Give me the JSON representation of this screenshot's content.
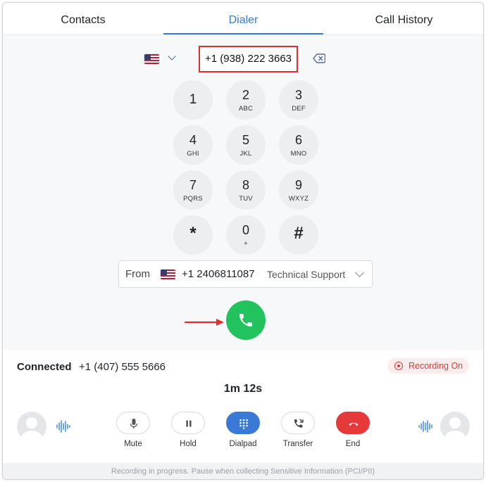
{
  "tabs": [
    {
      "label": "Contacts",
      "active": false
    },
    {
      "label": "Dialer",
      "active": true
    },
    {
      "label": "Call History",
      "active": false
    }
  ],
  "dialer": {
    "country_icon": "us-flag-icon",
    "number": "+1 (938) 222 3663",
    "keys": [
      {
        "digit": "1",
        "letters": ""
      },
      {
        "digit": "2",
        "letters": "ABC"
      },
      {
        "digit": "3",
        "letters": "DEF"
      },
      {
        "digit": "4",
        "letters": "GHI"
      },
      {
        "digit": "5",
        "letters": "JKL"
      },
      {
        "digit": "6",
        "letters": "MNO"
      },
      {
        "digit": "7",
        "letters": "PQRS"
      },
      {
        "digit": "8",
        "letters": "TUV"
      },
      {
        "digit": "9",
        "letters": "WXYZ"
      },
      {
        "digit": "*",
        "letters": ""
      },
      {
        "digit": "0",
        "letters": "+"
      },
      {
        "digit": "#",
        "letters": ""
      }
    ],
    "from": {
      "label": "From",
      "number": "+1 2406811087",
      "name": "Technical Support"
    }
  },
  "call": {
    "status": "Connected",
    "number": "+1 (407) 555 5666",
    "recording": "Recording On",
    "timer": "1m 12s",
    "controls": {
      "mute": "Mute",
      "hold": "Hold",
      "dialpad": "Dialpad",
      "transfer": "Transfer",
      "end": "End"
    }
  },
  "footer": {
    "notice": "Recording in progress. Pause when collecting Sensitive Information (PCI/PII)"
  },
  "colors": {
    "accent": "#3a79d6",
    "call_green": "#22c35e",
    "end_red": "#e5393a",
    "highlight_red": "#e0302e"
  }
}
